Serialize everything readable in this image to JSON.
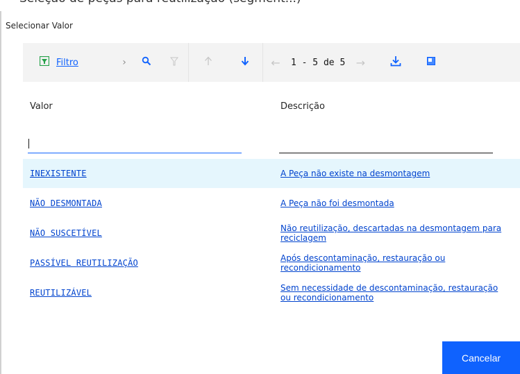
{
  "top_cut_text": "Seleção de peças para reutilização (segment...)",
  "dialog": {
    "title": "Selecionar Valor"
  },
  "toolbar": {
    "filter_label": "Filtro",
    "range_text": "1 - 5 de 5"
  },
  "table": {
    "columns": [
      "Valor",
      "Descrição"
    ],
    "filter_values": {
      "valor": "",
      "descricao": ""
    },
    "rows": [
      {
        "valor": "INEXISTENTE",
        "descricao": "A Peça não existe na desmontagem",
        "selected": true
      },
      {
        "valor": "NÃO DESMONTADA",
        "descricao": "A Peça não foi desmontada",
        "selected": false
      },
      {
        "valor": "NÃO SUSCETÍVEL",
        "descricao": "Não reutilização, descartadas na desmontagem para reciclagem",
        "selected": false
      },
      {
        "valor": "PASSÍVEL REUTILIZAÇÃO",
        "descricao": "Após descontaminação, restauração ou recondicionamento",
        "selected": false
      },
      {
        "valor": "REUTILIZÁVEL",
        "descricao": "Sem necessidade de descontaminação, restauração ou recondicionamento",
        "selected": false
      }
    ]
  },
  "footer": {
    "cancel_label": "Cancelar"
  },
  "colors": {
    "accent": "#0f62fe",
    "link": "#0043ce",
    "selected_row": "#e5f6fd",
    "toolbar_bg": "#f3f3f3",
    "filter_icon": "#24a148"
  }
}
